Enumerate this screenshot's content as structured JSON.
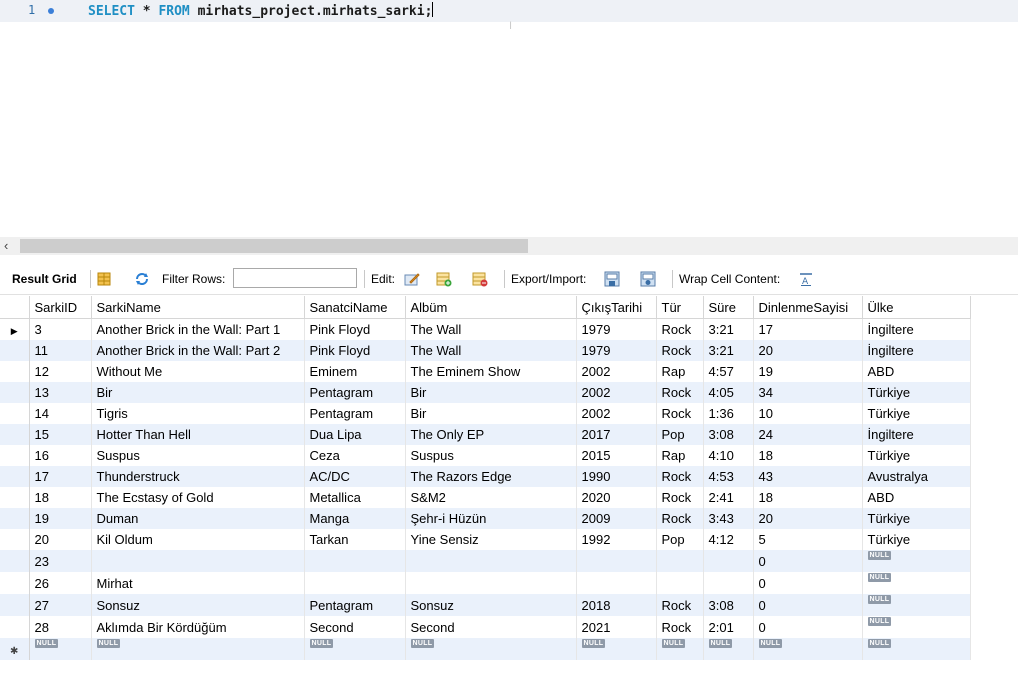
{
  "editor": {
    "line_number": "1",
    "code": {
      "select_kw": "SELECT",
      "star": " * ",
      "from_kw": "FROM",
      "rest": " mirhats_project.mirhats_sarki;"
    }
  },
  "toolbar": {
    "result_grid": "Result Grid",
    "filter_rows": "Filter Rows:",
    "filter_value": "",
    "edit": "Edit:",
    "export_import": "Export/Import:",
    "wrap_cell": "Wrap Cell Content:",
    "icons": [
      "form-editor-icon",
      "refresh-icon",
      "edit-row-icon",
      "add-row-icon",
      "delete-row-icon",
      "export-icon",
      "import-icon",
      "wrap-icon"
    ]
  },
  "grid": {
    "null_label": "NULL",
    "columns": [
      "SarkiID",
      "SarkiName",
      "SanatciName",
      "Albüm",
      "ÇıkışTarihi",
      "Tür",
      "Süre",
      "DinlenmeSayisi",
      "Ülke"
    ],
    "rows": [
      [
        "3",
        "Another Brick in the Wall: Part 1",
        "Pink Floyd",
        "The Wall",
        "1979",
        "Rock",
        "3:21",
        "17",
        "İngiltere"
      ],
      [
        "11",
        "Another Brick in the Wall: Part 2",
        "Pink Floyd",
        "The Wall",
        "1979",
        "Rock",
        "3:21",
        "20",
        "İngiltere"
      ],
      [
        "12",
        "Without Me",
        "Eminem",
        "The Eminem Show",
        "2002",
        "Rap",
        "4:57",
        "19",
        "ABD"
      ],
      [
        "13",
        "Bir",
        "Pentagram",
        "Bir",
        "2002",
        "Rock",
        "4:05",
        "34",
        "Türkiye"
      ],
      [
        "14",
        "Tigris",
        "Pentagram",
        "Bir",
        "2002",
        "Rock",
        "1:36",
        "10",
        "Türkiye"
      ],
      [
        "15",
        "Hotter Than Hell",
        "Dua Lipa",
        "The Only EP",
        "2017",
        "Pop",
        "3:08",
        "24",
        "İngiltere"
      ],
      [
        "16",
        "Suspus",
        "Ceza",
        "Suspus",
        "2015",
        "Rap",
        "4:10",
        "18",
        "Türkiye"
      ],
      [
        "17",
        "Thunderstruck",
        "AC/DC",
        "The Razors Edge",
        "1990",
        "Rock",
        "4:53",
        "43",
        "Avustralya"
      ],
      [
        "18",
        "The Ecstasy of Gold",
        "Metallica",
        "S&M2",
        "2020",
        "Rock",
        "2:41",
        "18",
        "ABD"
      ],
      [
        "19",
        "Duman",
        "Manga",
        "Şehr-i Hüzün",
        "2009",
        "Rock",
        "3:43",
        "20",
        "Türkiye"
      ],
      [
        "20",
        "Kil Oldum",
        "Tarkan",
        "Yine Sensiz",
        "1992",
        "Pop",
        "4:12",
        "5",
        "Türkiye"
      ],
      [
        "23",
        "",
        "",
        "",
        "",
        "",
        "",
        "0",
        null
      ],
      [
        "26",
        "Mirhat",
        "",
        "",
        "",
        "",
        "",
        "0",
        null
      ],
      [
        "27",
        "Sonsuz",
        "Pentagram",
        "Sonsuz",
        "2018",
        "Rock",
        "3:08",
        "0",
        null
      ],
      [
        "28",
        "Aklımda Bir Kördüğüm",
        "Second",
        "Second",
        "2021",
        "Rock",
        "2:01",
        "0",
        null
      ],
      [
        null,
        null,
        null,
        null,
        null,
        null,
        null,
        null,
        null
      ]
    ]
  }
}
